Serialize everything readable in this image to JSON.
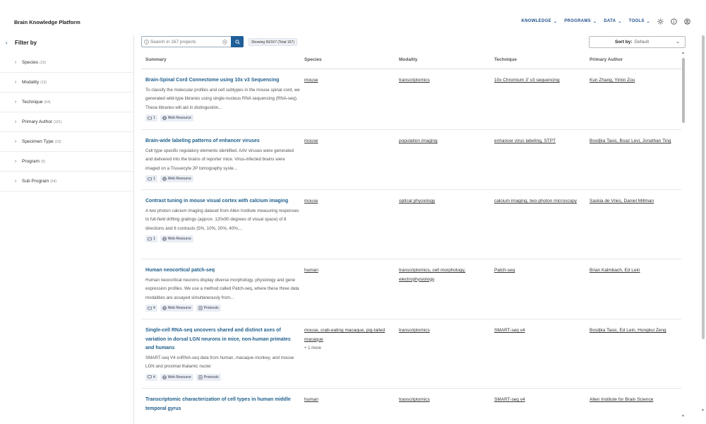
{
  "app": {
    "title": "Brain Knowledge Platform"
  },
  "nav": {
    "items": [
      {
        "label": "KNOWLEDGE"
      },
      {
        "label": "PROGRAMS"
      },
      {
        "label": "DATA"
      },
      {
        "label": "TOOLS"
      }
    ],
    "icons": [
      "sun-icon",
      "info-icon",
      "user-icon"
    ]
  },
  "sidebar": {
    "title": "Filter by",
    "facets": [
      {
        "label": "Species",
        "count": "(23)"
      },
      {
        "label": "Modality",
        "count": "(13)"
      },
      {
        "label": "Technique",
        "count": "(64)"
      },
      {
        "label": "Primary Author",
        "count": "(101)"
      },
      {
        "label": "Specimen Type",
        "count": "(19)"
      },
      {
        "label": "Program",
        "count": "(5)"
      },
      {
        "label": "Sub Program",
        "count": "(54)"
      }
    ]
  },
  "search": {
    "placeholder": "Search in 167 projects"
  },
  "showing": "Showing 50/167 (Total 167)",
  "sort": {
    "label": "Sort by:",
    "value": "Default"
  },
  "table": {
    "headers": [
      "Summary",
      "Species",
      "Modality",
      "Technique",
      "Primary Author"
    ],
    "rows": [
      {
        "title": "Brain-Spinal Cord Connectome using 10x v3 Sequencing",
        "desc": "To classify the molecular profiles and cell subtypes in the mouse spinal cord, we generated wild-type libraries using single-nucleus RNA sequencing (RNA-seq). These libraries will aid in distinguishin...",
        "count": "1",
        "badges": [
          "Web Resource"
        ],
        "species": "mouse",
        "modality": "transcriptomics",
        "technique": "10x Chromium 3' v3 sequencing",
        "author": "Kun Zhang, Yimin Zou"
      },
      {
        "title": "Brain-wide labeling patterns of enhancer viruses",
        "desc": "Cell type specific regulatory elements identified. AAV viruses were generated and delivered into the brains of reporter mice. Virus-infected brains were imaged on a Tissuecyte 2P tomography syste...",
        "count": "1",
        "badges": [
          "Web Resource"
        ],
        "species": "mouse",
        "modality": "population imaging",
        "technique": "enhancer virus labeling, STPT",
        "author": "Bosiljka Tasic, Boaz Levi, Jonathan Ting"
      },
      {
        "title": "Contrast tuning in mouse visual cortex with calcium imaging",
        "desc": "A two photon calcium imaging dataset from Allen Institute measuring responses to full-field drifting gratings (approx. 120x90 degrees of visual space) of 8 directions and 6 contrasts (5%, 10%, 20%, 40%,...",
        "count": "1",
        "badges": [
          "Web Resource"
        ],
        "species": "mouse",
        "modality": "optical physiology",
        "technique": "calcium imaging, two-photon microscopy",
        "author": "Saskia de Vries, Daniel Millman"
      },
      {
        "title": "Human neocortical patch-seq",
        "desc": "Human neocortical neurons display diverse morphology, physiology and gene expression profiles. We use a method called Patch-seq, where these three data modalities are assayed simultaneously from...",
        "count": "4",
        "badges": [
          "Web Resource",
          "Protocols"
        ],
        "species": "human",
        "modality": "transcriptomics, cell morphology, electrophysiology",
        "technique": "Patch-seq",
        "author": "Brian Kalmbach, Ed Lein"
      },
      {
        "title": "Single-cell RNA-seq uncovers shared and distinct axes of variation in dorsal LGN neurons in mice, non-human primates and humans",
        "desc": "SMART-seq V4 snRNA-seq data from human, macaque monkey, and mouse LGN and proximal thalamic nuclei",
        "count": "4",
        "badges": [
          "Web Resource",
          "Protocols"
        ],
        "species": "mouse, crab-eating macaque, pig-tailed macaque",
        "species_more": "+ 1 more",
        "modality": "transcriptomics",
        "technique": "SMART-seq v4",
        "author": "Bosiljka Tasic, Ed Lein, Hongkui Zeng"
      },
      {
        "title": "Transcriptomic characterization of cell types in human middle temporal gyrus",
        "desc": "",
        "count": "",
        "badges": [],
        "species": "human",
        "modality": "transcriptomics",
        "technique": "SMART-seq v4",
        "author": "Allen Institute for Brain Science"
      }
    ]
  }
}
